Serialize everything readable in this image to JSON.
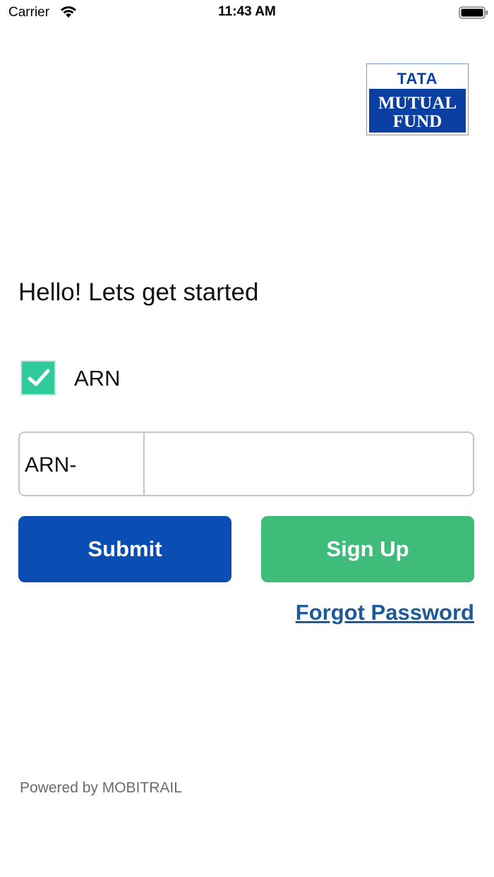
{
  "status_bar": {
    "carrier": "Carrier",
    "time": "11:43 AM",
    "wifi_icon": "wifi-icon",
    "battery_icon": "battery-icon"
  },
  "logo": {
    "brand_top": "TATA",
    "line1": "MUTUAL",
    "line2": "FUND",
    "colors": {
      "blue": "#0b3fa1",
      "white": "#ffffff"
    }
  },
  "greeting": "Hello! Lets get started",
  "arn_option": {
    "label": "ARN",
    "checked": true,
    "check_color": "#2fcb9a"
  },
  "arn_field": {
    "prefix": "ARN-",
    "value": "",
    "placeholder": ""
  },
  "buttons": {
    "submit": "Submit",
    "sign_up": "Sign Up",
    "submit_color": "#0a4db3",
    "sign_up_color": "#3fbc79"
  },
  "forgot_password": "Forgot Password",
  "footer": {
    "powered_by": "Powered by MOBITRAIL"
  }
}
